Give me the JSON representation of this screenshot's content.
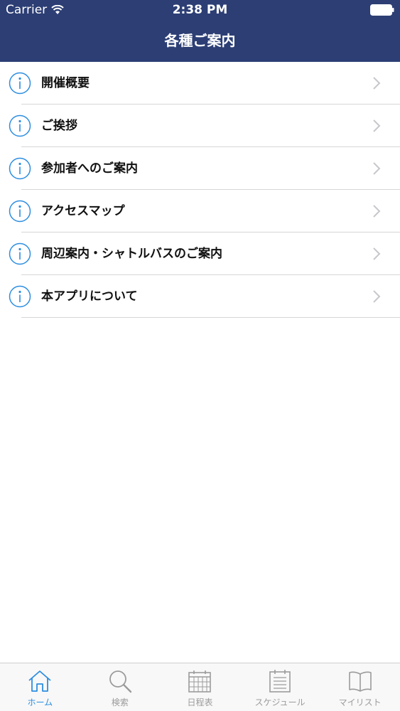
{
  "status_bar": {
    "carrier": "Carrier",
    "time": "2:38 PM"
  },
  "nav": {
    "title": "各種ご案内"
  },
  "menu": {
    "items": [
      {
        "label": "開催概要"
      },
      {
        "label": "ご挨拶"
      },
      {
        "label": "参加者へのご案内"
      },
      {
        "label": "アクセスマップ"
      },
      {
        "label": "周辺案内・シャトルバスのご案内"
      },
      {
        "label": "本アプリについて"
      }
    ]
  },
  "tab_bar": {
    "tabs": [
      {
        "label": "ホーム",
        "icon": "home-icon",
        "active": true
      },
      {
        "label": "検索",
        "icon": "search-icon",
        "active": false
      },
      {
        "label": "日程表",
        "icon": "calendar-icon",
        "active": false
      },
      {
        "label": "スケジュール",
        "icon": "schedule-icon",
        "active": false
      },
      {
        "label": "マイリスト",
        "icon": "book-icon",
        "active": false
      }
    ]
  },
  "colors": {
    "header_bg": "#2c3e74",
    "accent": "#2d8ee0",
    "inactive": "#9b9b9b",
    "separator": "#d6d6d6"
  }
}
